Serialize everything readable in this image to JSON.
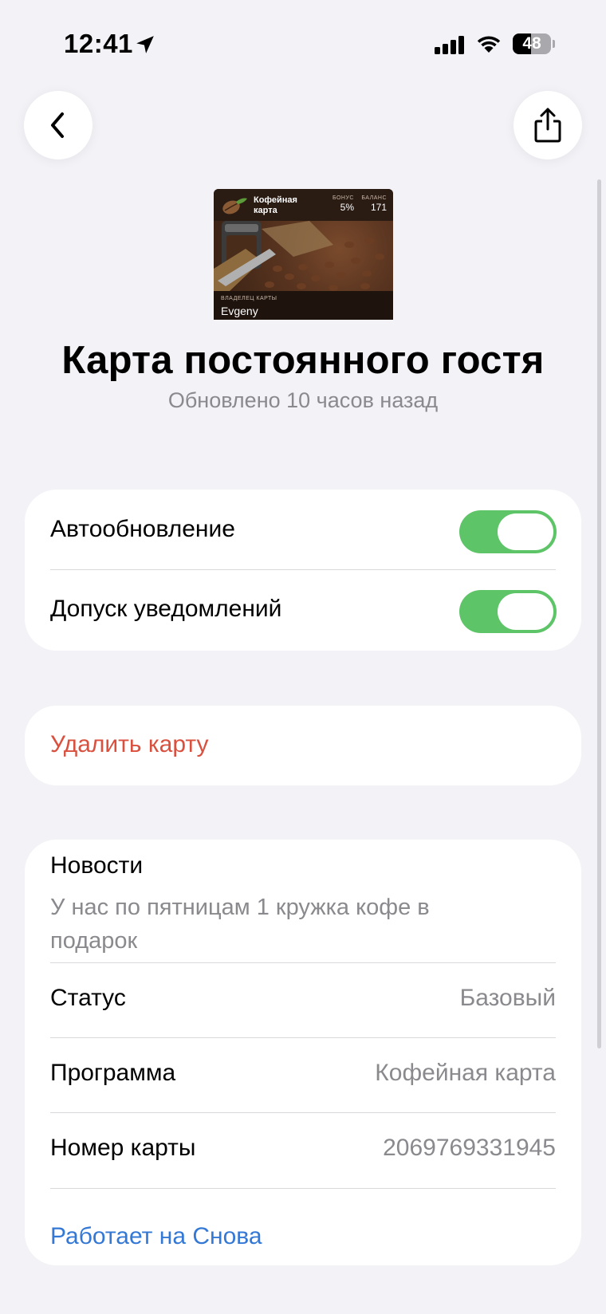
{
  "status_bar": {
    "time": "12:41",
    "battery": "48",
    "battery_level": 0.48
  },
  "nav": {
    "back_icon": "chevron-left-icon",
    "share_icon": "share-icon"
  },
  "pass": {
    "name": "Кофейная карта",
    "bonus_label": "БОНУС",
    "bonus_value": "5%",
    "balance_label": "БАЛАНС",
    "balance_value": "171",
    "owner_label": "ВЛАДЕЛЕЦ КАРТЫ",
    "owner_name": "Evgeny"
  },
  "header": {
    "title": "Карта постоянного гостя",
    "subtitle": "Обновлено 10 часов назад"
  },
  "settings": {
    "auto_update_label": "Автообновление",
    "auto_update_on": true,
    "notifications_label": "Допуск уведомлений",
    "notifications_on": true
  },
  "delete": {
    "label": "Удалить карту",
    "color": "#d9503f"
  },
  "info": {
    "news_title": "Новости",
    "news_text": "У нас по пятницам 1 кружка кофе в подарок",
    "status_label": "Статус",
    "status_value": "Базовый",
    "program_label": "Программа",
    "program_value": "Кофейная карта",
    "card_number_label": "Номер карты",
    "card_number_value": "2069769331945",
    "powered_by": "Работает на Снова",
    "link_color": "#3478d6"
  },
  "colors": {
    "background": "#f2f2f7",
    "toggle_on": "#5ec468"
  }
}
